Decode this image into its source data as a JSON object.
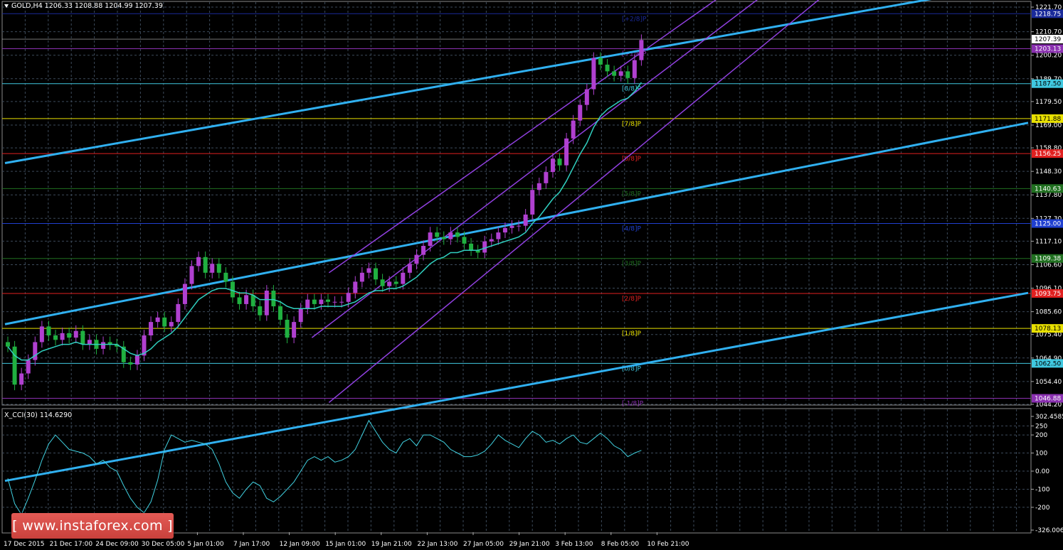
{
  "symbol_header": "GOLD,H4  1206.33 1208.88 1204.99 1207.39",
  "indicator_header": "X_CCI(30) 114.6290",
  "watermark": "[ www.instaforex.com ]",
  "colors": {
    "background": "#000000",
    "grid": "#3c4a5a",
    "bull_candle": "#b040d0",
    "bear_candle": "#20b040",
    "ma_line": "#30d0c0",
    "trend_line": "#30b0f0",
    "channel_line": "#9040e0",
    "cci_line": "#40d0e0",
    "axis_text": "#ffffff"
  },
  "price_axis": {
    "min": 1044.2,
    "max": 1221.7,
    "ticks": [
      "1221.70",
      "1210.70",
      "1200.20",
      "1189.70",
      "1179.50",
      "1169.00",
      "1158.80",
      "1148.30",
      "1137.80",
      "1127.30",
      "1117.10",
      "1106.60",
      "1096.10",
      "1085.60",
      "1075.40",
      "1064.90",
      "1054.40",
      "1044.20"
    ],
    "tick_values": [
      1221.7,
      1210.7,
      1200.2,
      1189.7,
      1179.5,
      1169.0,
      1158.8,
      1148.3,
      1137.8,
      1127.3,
      1117.1,
      1106.6,
      1096.1,
      1085.6,
      1075.4,
      1064.9,
      1054.4,
      1044.2
    ]
  },
  "cci_axis": {
    "min": -326.0061,
    "max": 302.4585,
    "ticks": [
      "302.4585",
      "250",
      "200",
      "100",
      "0.00",
      "-100",
      "-200",
      "-326.0061"
    ],
    "tick_values": [
      302.4585,
      250,
      200,
      100,
      0,
      -100,
      -200,
      -326.0061
    ]
  },
  "time_axis": {
    "labels": [
      "17 Dec 2015",
      "21 Dec 17:00",
      "24 Dec 09:00",
      "30 Dec 05:00",
      "5 Jan 01:00",
      "7 Jan 17:00",
      "12 Jan 09:00",
      "15 Jan 01:00",
      "19 Jan 21:00",
      "22 Jan 13:00",
      "27 Jan 05:00",
      "29 Jan 21:00",
      "3 Feb 13:00",
      "8 Feb 05:00",
      "10 Feb 21:00"
    ]
  },
  "murrey_levels": [
    {
      "label": "[+2/8]P",
      "value": 1218.75,
      "price_label": "1218.75",
      "color": "#1a2a9a"
    },
    {
      "label": "[+1/8]P",
      "value": 1203.13,
      "price_label": "1203.13",
      "color": "#8a30b0"
    },
    {
      "label": "[8/8]P",
      "value": 1187.5,
      "price_label": "1187.50",
      "color": "#40c8e0"
    },
    {
      "label": "[7/8]P",
      "value": 1171.88,
      "price_label": "1171.88",
      "color": "#e8e000"
    },
    {
      "label": "[6/8]P",
      "value": 1156.25,
      "price_label": "1156.25",
      "color": "#e02020"
    },
    {
      "label": "[5/8]P",
      "value": 1140.63,
      "price_label": "1140.63",
      "color": "#207020"
    },
    {
      "label": "[4/8]P",
      "value": 1125.0,
      "price_label": "1125.00",
      "color": "#2040d0"
    },
    {
      "label": "[3/8]P",
      "value": 1109.38,
      "price_label": "1109.38",
      "color": "#207020"
    },
    {
      "label": "[2/8]P",
      "value": 1093.75,
      "price_label": "1093.75",
      "color": "#e02020"
    },
    {
      "label": "[1/8]P",
      "value": 1078.13,
      "price_label": "1078.13",
      "color": "#e8e000"
    },
    {
      "label": "[0/8]P",
      "value": 1062.5,
      "price_label": "1062.50",
      "color": "#40c8e0"
    },
    {
      "label": "[-1/8]P",
      "value": 1046.88,
      "price_label": "1046.88",
      "color": "#8a30b0"
    }
  ],
  "current_price": {
    "value": 1207.39,
    "label": "1207.39"
  },
  "chart_data": {
    "type": "candlestick",
    "series": [
      {
        "name": "price_closes",
        "values": [
          1070,
          1053,
          1058,
          1064,
          1072,
          1079,
          1075,
          1073,
          1076,
          1074,
          1077,
          1071,
          1073,
          1069,
          1072,
          1071,
          1070,
          1063,
          1062,
          1066,
          1075,
          1081,
          1083,
          1079,
          1081,
          1089,
          1098,
          1106,
          1110,
          1103,
          1107,
          1103,
          1099,
          1092,
          1089,
          1093,
          1088,
          1084,
          1095,
          1088,
          1082,
          1074,
          1081,
          1087,
          1091,
          1089,
          1091,
          1090,
          1090,
          1090,
          1094,
          1099,
          1103,
          1105,
          1100,
          1097,
          1099,
          1098,
          1103,
          1107,
          1111,
          1115,
          1121,
          1119,
          1118,
          1121,
          1119,
          1116,
          1113,
          1112,
          1117,
          1118,
          1121,
          1123,
          1124,
          1124,
          1129,
          1140,
          1143,
          1148,
          1154,
          1151,
          1163,
          1171,
          1178,
          1185,
          1199,
          1196,
          1193,
          1191,
          1193,
          1190,
          1198,
          1207
        ]
      }
    ],
    "ma_values": [
      1070,
      1066,
      1064,
      1064,
      1066,
      1068,
      1069,
      1070,
      1071,
      1071,
      1072,
      1071,
      1071,
      1071,
      1071,
      1071,
      1071,
      1069,
      1067,
      1066,
      1067,
      1069,
      1072,
      1074,
      1076,
      1079,
      1083,
      1087,
      1091,
      1093,
      1095,
      1096,
      1096,
      1095,
      1094,
      1094,
      1093,
      1091,
      1091,
      1091,
      1090,
      1088,
      1087,
      1087,
      1087,
      1087,
      1088,
      1088,
      1088,
      1088,
      1089,
      1090,
      1092,
      1094,
      1095,
      1095,
      1096,
      1096,
      1097,
      1099,
      1101,
      1104,
      1107,
      1109,
      1110,
      1112,
      1112,
      1113,
      1113,
      1113,
      1114,
      1115,
      1116,
      1117,
      1118,
      1119,
      1121,
      1125,
      1128,
      1132,
      1136,
      1139,
      1144,
      1150,
      1156,
      1161,
      1168,
      1173,
      1176,
      1178,
      1180,
      1181,
      1184,
      1188
    ],
    "cci_values": [
      -40,
      -180,
      -240,
      -150,
      -50,
      60,
      150,
      200,
      160,
      120,
      110,
      100,
      80,
      40,
      60,
      20,
      0,
      -80,
      -150,
      -200,
      -230,
      -170,
      -50,
      120,
      200,
      180,
      160,
      170,
      160,
      150,
      120,
      40,
      -60,
      -120,
      -150,
      -100,
      -60,
      -80,
      -150,
      -170,
      -140,
      -100,
      -60,
      0,
      60,
      80,
      60,
      80,
      50,
      60,
      80,
      120,
      200,
      280,
      220,
      160,
      120,
      100,
      160,
      180,
      140,
      200,
      200,
      180,
      160,
      120,
      100,
      80,
      80,
      90,
      110,
      150,
      200,
      170,
      150,
      130,
      180,
      220,
      200,
      160,
      170,
      150,
      180,
      200,
      160,
      150,
      180,
      210,
      180,
      140,
      120,
      80,
      100,
      114.63
    ],
    "trend_lines": [
      {
        "name": "upper_trend",
        "p1": [
          0,
          1152
        ],
        "p2": [
          120,
          1233
        ]
      },
      {
        "name": "middle_trend",
        "p1": [
          0,
          1080
        ],
        "p2": [
          120,
          1170
        ]
      },
      {
        "name": "lower_trend",
        "p1": [
          0,
          1010
        ],
        "p2": [
          120,
          1094
        ]
      }
    ],
    "channel_lines": [
      {
        "name": "channel_upper",
        "p1": [
          38,
          1103
        ],
        "p2": [
          86,
          1232
        ]
      },
      {
        "name": "channel_mid",
        "p1": [
          36,
          1074
        ],
        "p2": [
          91,
          1233
        ]
      },
      {
        "name": "channel_lower",
        "p1": [
          38,
          1045
        ],
        "p2": [
          98,
          1233
        ]
      }
    ]
  }
}
